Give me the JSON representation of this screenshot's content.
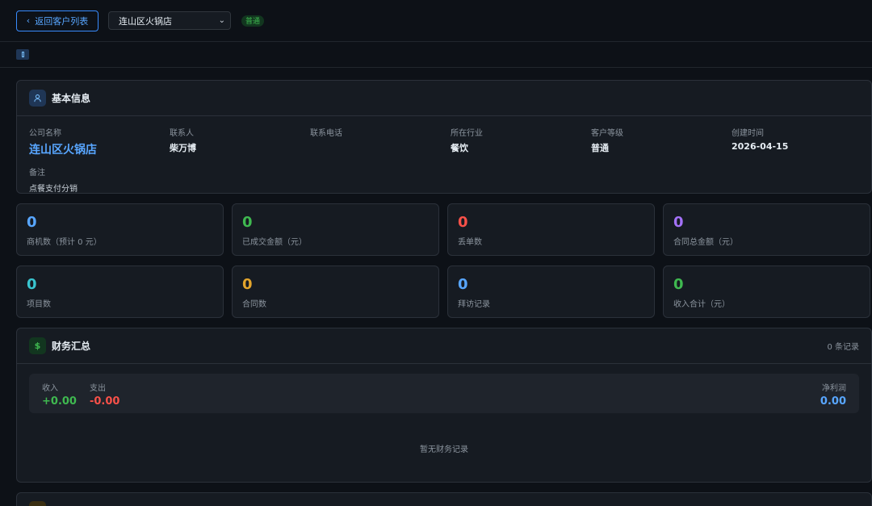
{
  "header": {
    "back_label": "返回客户列表",
    "customer_select_value": "连山区火锅店",
    "level_badge": "普通"
  },
  "basic_info": {
    "title": "基本信息",
    "fields": [
      {
        "label": "公司名称",
        "value": "连山区火锅店"
      },
      {
        "label": "联系人",
        "value": "柴万博"
      },
      {
        "label": "联系电话",
        "value": ""
      },
      {
        "label": "所在行业",
        "value": "餐饮"
      },
      {
        "label": "客户等级",
        "value": "普通"
      },
      {
        "label": "创建时间",
        "value": "2026-04-15"
      }
    ],
    "remark_label": "备注",
    "remark_value": "点餐支付分销"
  },
  "stats": [
    {
      "value": "0",
      "label": "商机数（预计 0 元）",
      "color": "#58a6ff"
    },
    {
      "value": "0",
      "label": "已成交金额（元）",
      "color": "#3fb950"
    },
    {
      "value": "0",
      "label": "丢单数",
      "color": "#f85149"
    },
    {
      "value": "0",
      "label": "合同总金额（元）",
      "color": "#a371f7"
    },
    {
      "value": "0",
      "label": "项目数",
      "color": "#39c5cf"
    },
    {
      "value": "0",
      "label": "合同数",
      "color": "#e3a52c"
    },
    {
      "value": "0",
      "label": "拜访记录",
      "color": "#58a6ff"
    },
    {
      "value": "0",
      "label": "收入合计（元）",
      "color": "#3fb950"
    }
  ],
  "finance": {
    "title": "财务汇总",
    "record_count": "0 条记录",
    "income_label": "收入",
    "income_value": "+0.00",
    "expense_label": "支出",
    "expense_value": "-0.00",
    "net_label": "净利润",
    "net_value": "0.00",
    "empty_text": "暂无财务记录"
  },
  "colors": {
    "accent": "#58a6ff",
    "income": "#3fb950",
    "expense": "#f85149"
  }
}
